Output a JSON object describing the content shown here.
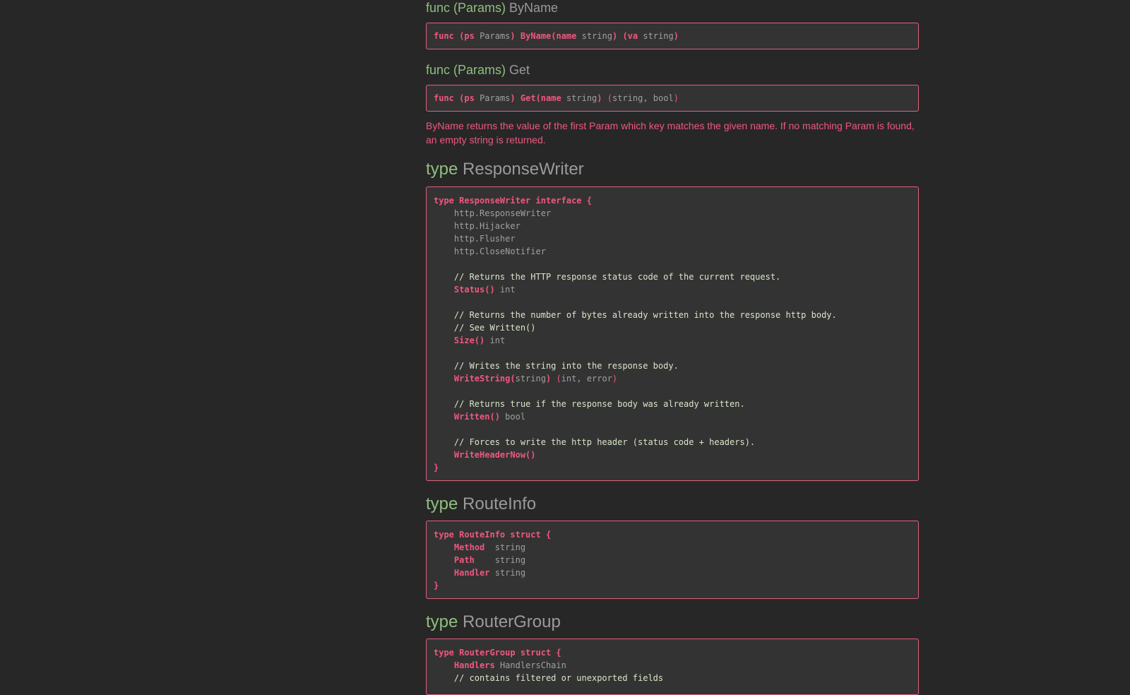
{
  "byname": {
    "heading_prefix": "func (Params)",
    "heading_name": "ByName",
    "sig": {
      "func_kw": "func",
      "recv_open": "(ps",
      "recv_type": "Params",
      "recv_close": ")",
      "name": "ByName(name",
      "ptype": "string",
      "close": ")",
      "ret_open": "(va",
      "ret_type": "string",
      "ret_close": ")"
    }
  },
  "get": {
    "heading_prefix": "func (Params)",
    "heading_name": "Get",
    "sig": {
      "func_kw": "func",
      "recv_open": "(ps",
      "recv_type": "Params",
      "recv_close": ")",
      "name": "Get(name",
      "ptype": "string",
      "close": ")",
      "ret_open": "(",
      "ret_types": "string, bool",
      "ret_close": ")"
    },
    "description": "ByName returns the value of the first Param which key matches the given name. If no matching Param is found, an empty string is returned."
  },
  "responsewriter": {
    "heading_kw": "type",
    "heading_name": "ResponseWriter",
    "decl": "type ResponseWriter interface {",
    "embeds": [
      "http.ResponseWriter",
      "http.Hijacker",
      "http.Flusher",
      "http.CloseNotifier"
    ],
    "c_status": "// Returns the HTTP response status code of the current request.",
    "m_status": "Status()",
    "t_status": "int",
    "c_size_1": "// Returns the number of bytes already written into the response http body.",
    "c_size_2": "// See Written()",
    "m_size": "Size()",
    "t_size": "int",
    "c_writestring": "// Writes the string into the response body.",
    "m_writestring": "WriteString(",
    "a_writestring": "string",
    "m_writestring_close": ")",
    "r_writestring_open": "(",
    "r_writestring": "int, error",
    "r_writestring_close": ")",
    "c_written": "// Returns true if the response body was already written.",
    "m_written": "Written()",
    "t_written": "bool",
    "c_header": "// Forces to write the http header (status code + headers).",
    "m_header": "WriteHeaderNow()",
    "close": "}"
  },
  "routeinfo": {
    "heading_kw": "type",
    "heading_name": "RouteInfo",
    "decl": "type RouteInfo struct {",
    "fields": [
      {
        "name": "Method",
        "type": "string"
      },
      {
        "name": "Path",
        "type": "string"
      },
      {
        "name": "Handler",
        "type": "string"
      }
    ],
    "close": "}"
  },
  "routergroup": {
    "heading_kw": "type",
    "heading_name": "RouterGroup",
    "decl": "type RouterGroup struct {",
    "field_name": "Handlers",
    "field_type": "HandlersChain",
    "comment": "// contains filtered or unexported fields"
  }
}
